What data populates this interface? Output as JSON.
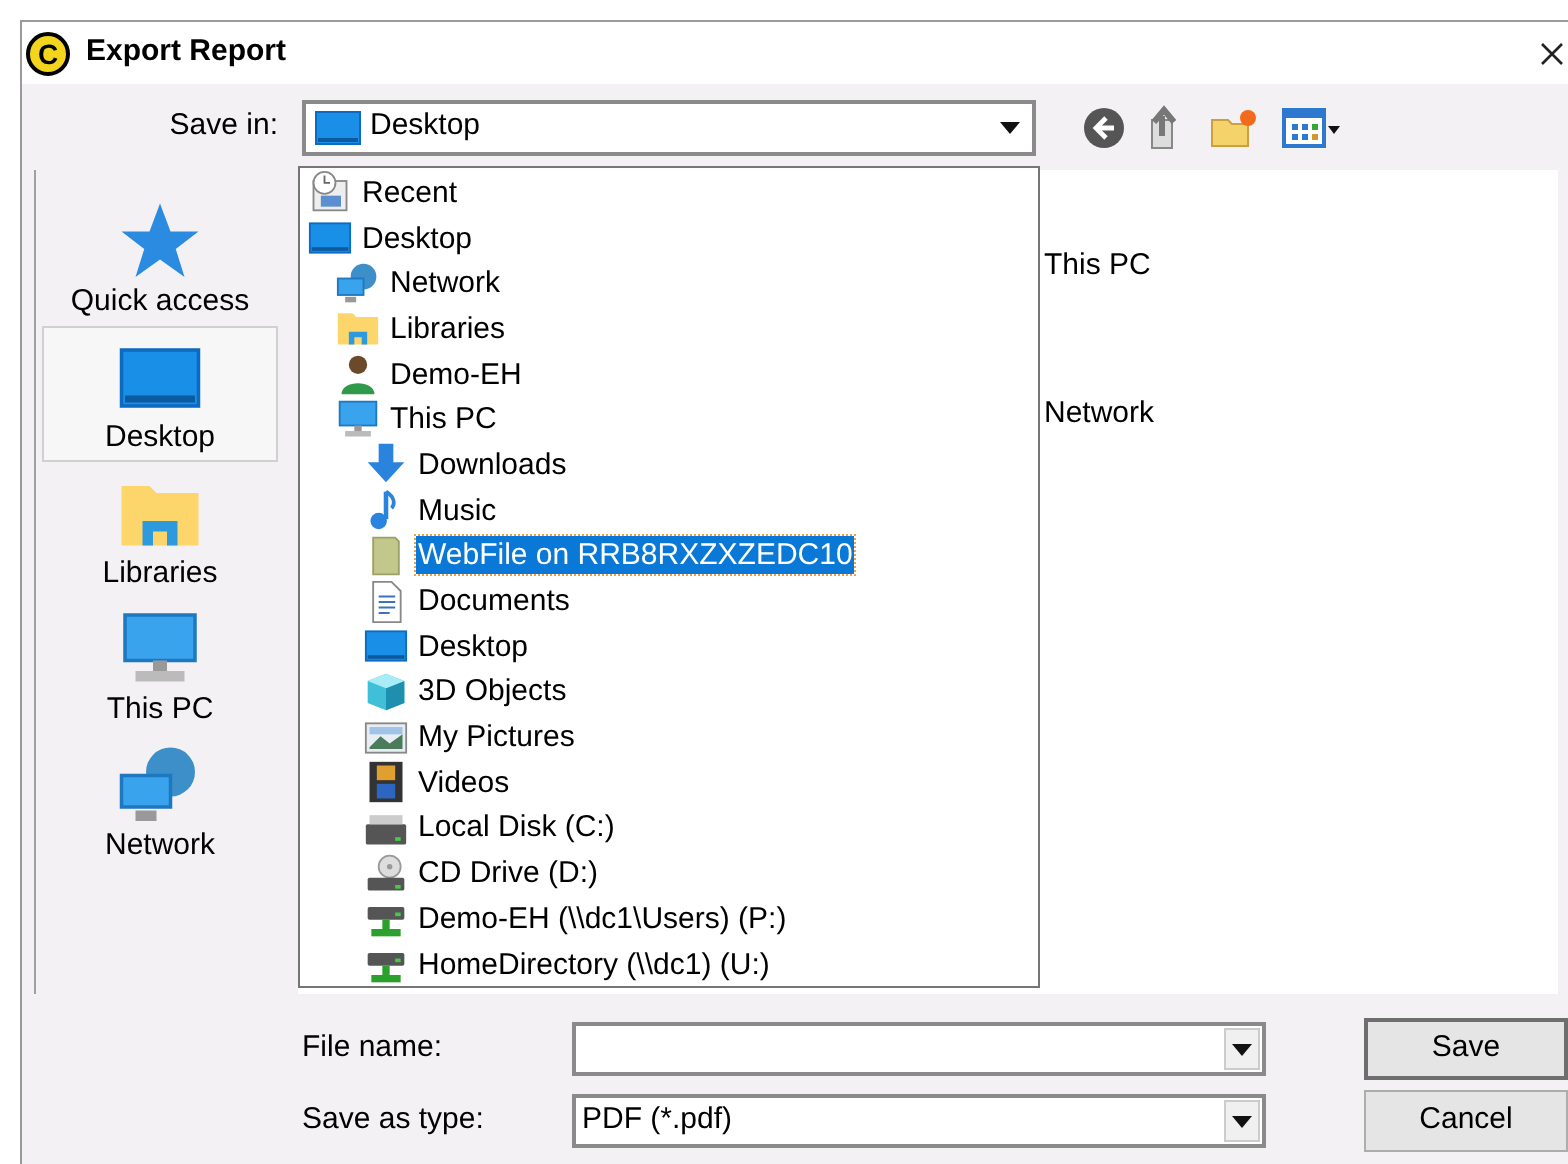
{
  "window": {
    "logo_letter": "C",
    "title": "Export Report"
  },
  "save_in": {
    "label": "Save in:",
    "value": "Desktop",
    "expanded": true
  },
  "sidebar": {
    "items": [
      {
        "label": "Quick access",
        "kind": "star",
        "selected": false
      },
      {
        "label": "Desktop",
        "kind": "desktop",
        "selected": true
      },
      {
        "label": "Libraries",
        "kind": "libraries",
        "selected": false
      },
      {
        "label": "This PC",
        "kind": "pc",
        "selected": false
      },
      {
        "label": "Network",
        "kind": "network",
        "selected": false
      }
    ]
  },
  "file_list": {
    "items": [
      {
        "label": "This PC"
      },
      {
        "label": "Network"
      }
    ]
  },
  "location_dropdown": {
    "items": [
      {
        "label": "Recent",
        "kind": "recent",
        "selected": false
      },
      {
        "label": "Desktop",
        "kind": "desktop",
        "selected": false,
        "children": [
          {
            "label": "Network",
            "kind": "network",
            "selected": false
          },
          {
            "label": "Libraries",
            "kind": "libraries",
            "selected": false
          },
          {
            "label": "Demo-EH",
            "kind": "user",
            "selected": false
          },
          {
            "label": "This PC",
            "kind": "pc",
            "selected": false,
            "children": [
              {
                "label": "Downloads",
                "kind": "downloads",
                "selected": false
              },
              {
                "label": "Music",
                "kind": "music",
                "selected": false
              },
              {
                "label": "WebFile on RRB8RXZXZEDC10",
                "kind": "webfile",
                "selected": true
              },
              {
                "label": "Documents",
                "kind": "documents",
                "selected": false
              },
              {
                "label": "Desktop",
                "kind": "desktop",
                "selected": false
              },
              {
                "label": "3D Objects",
                "kind": "objects3d",
                "selected": false
              },
              {
                "label": "My Pictures",
                "kind": "pictures",
                "selected": false
              },
              {
                "label": "Videos",
                "kind": "videos",
                "selected": false
              },
              {
                "label": "Local Disk (C:)",
                "kind": "disk",
                "selected": false
              },
              {
                "label": "CD Drive (D:)",
                "kind": "cd",
                "selected": false
              },
              {
                "label": "Demo-EH (\\\\dc1\\Users) (P:)",
                "kind": "netdrive",
                "selected": false
              },
              {
                "label": "HomeDirectory (\\\\dc1) (U:)",
                "kind": "netdrive",
                "selected": false
              }
            ]
          }
        ]
      }
    ]
  },
  "file_name": {
    "label": "File name:"
  },
  "save_as_type": {
    "label": "Save as type:",
    "value": "PDF (*.pdf)"
  },
  "buttons": [
    {
      "label": "Save",
      "kind": "default"
    },
    {
      "label": "Cancel",
      "kind": "normal"
    }
  ]
}
